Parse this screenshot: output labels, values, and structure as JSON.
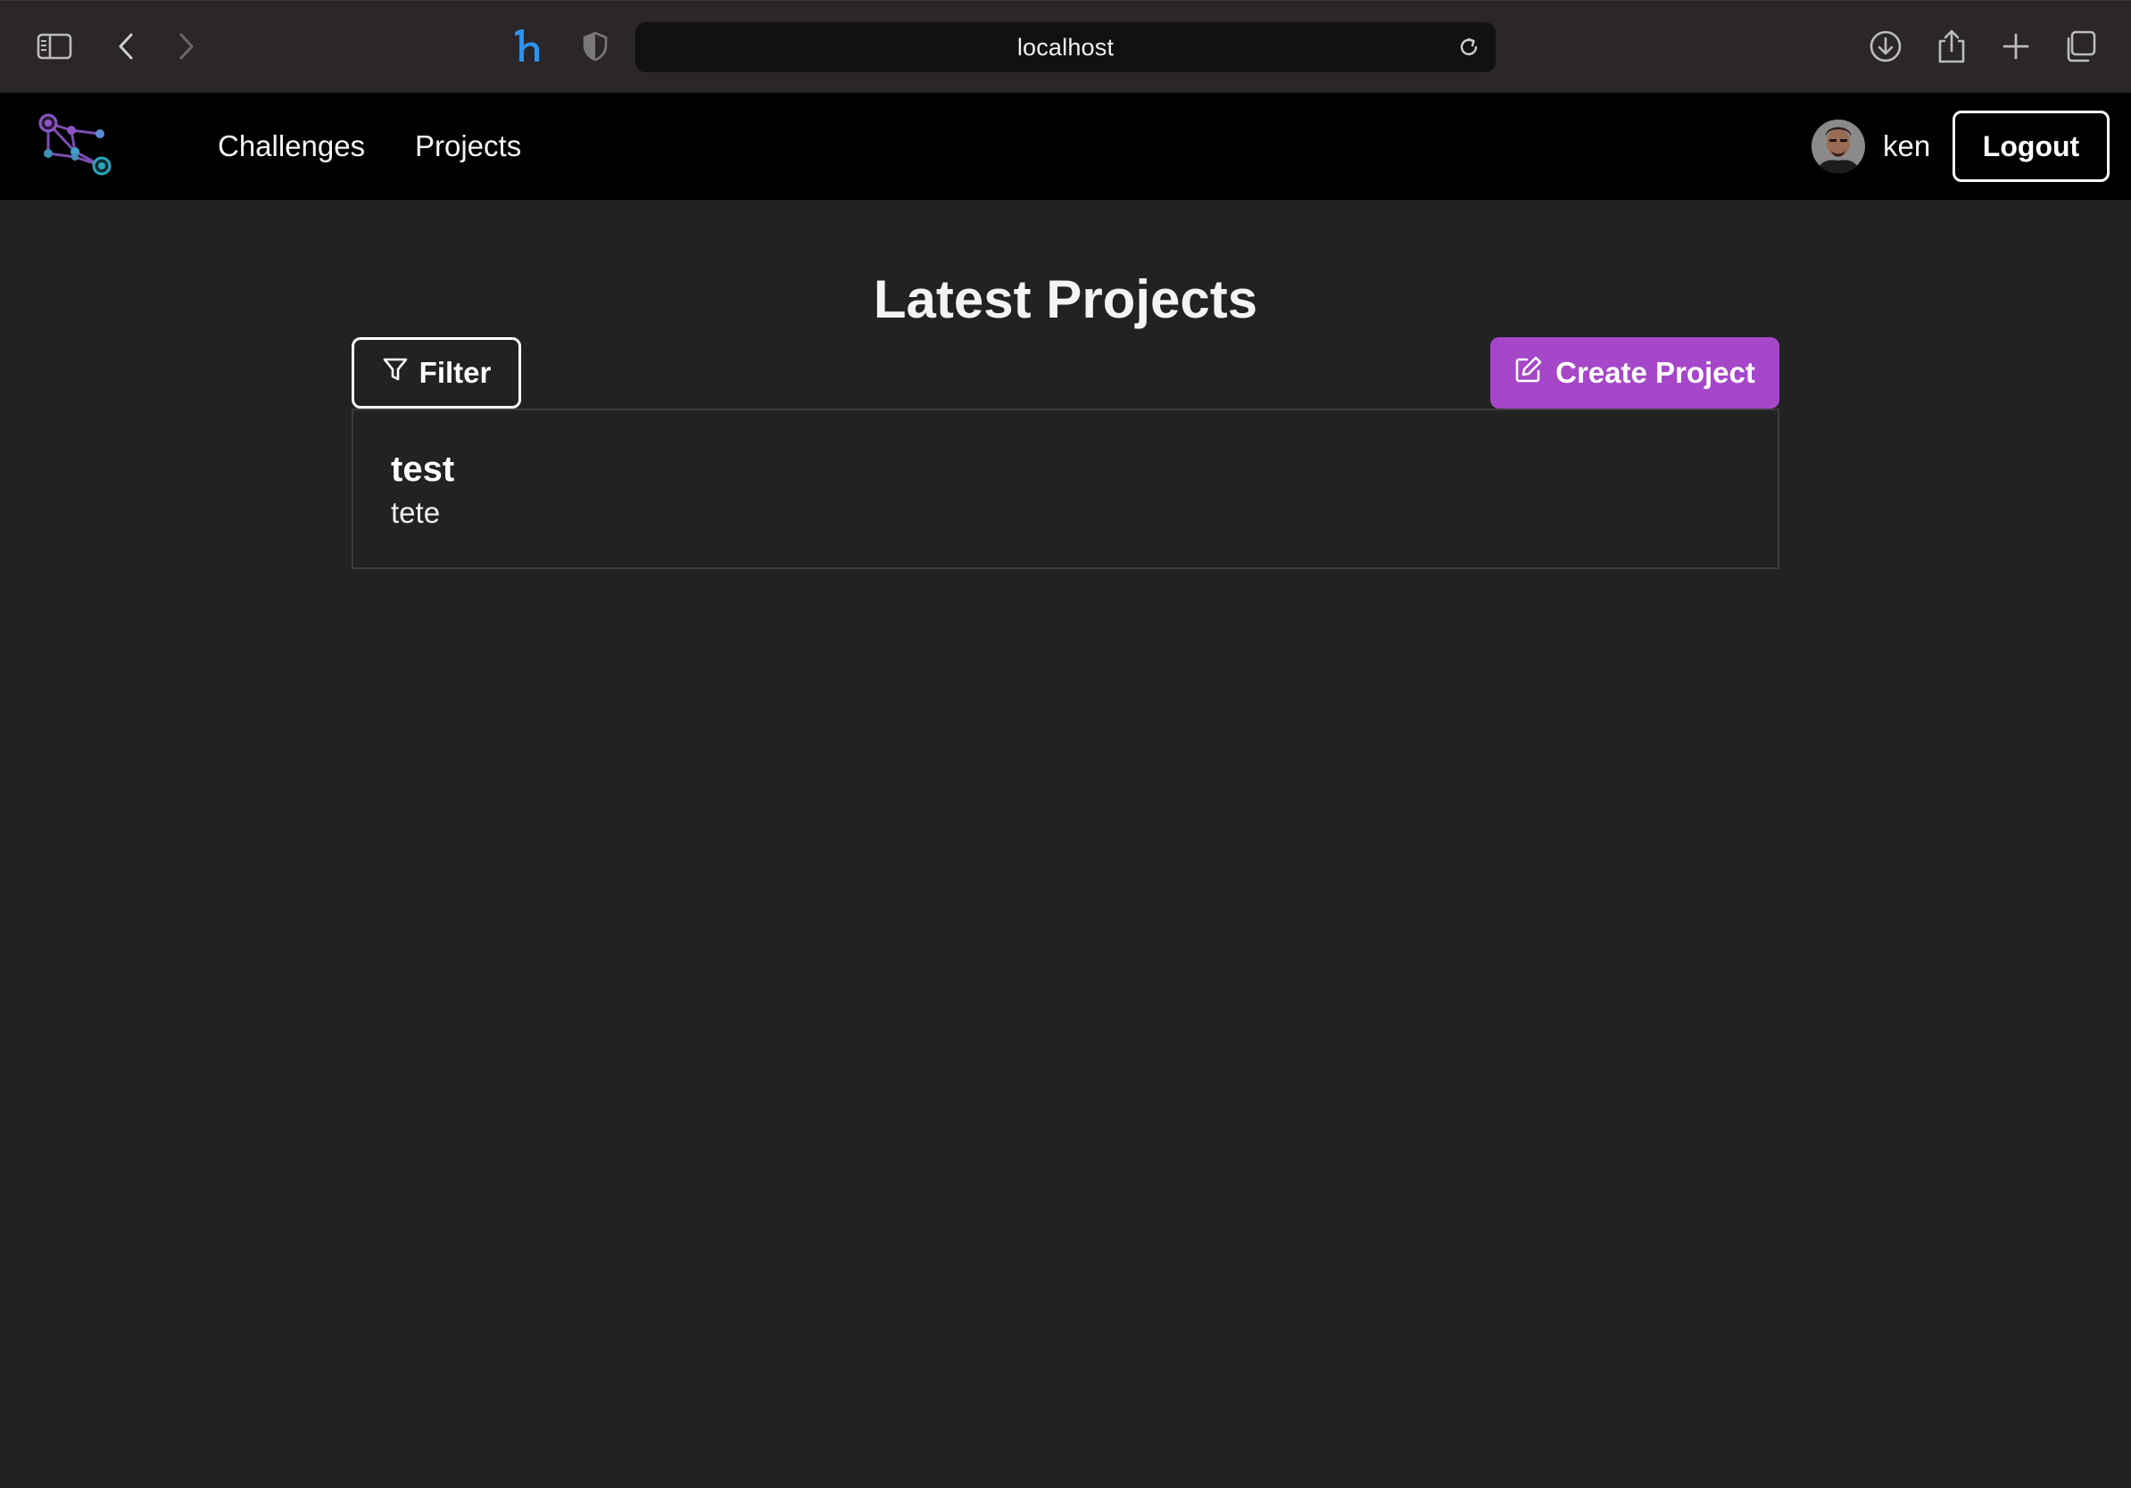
{
  "browser": {
    "url": "localhost",
    "icons": [
      "sidebar-toggle-icon",
      "back-icon",
      "forward-icon",
      "honey-extension-icon",
      "shield-icon",
      "reload-icon",
      "download-icon",
      "share-icon",
      "new-tab-icon",
      "tabs-overview-icon"
    ]
  },
  "nav": {
    "links": [
      "Challenges",
      "Projects"
    ],
    "username": "ken",
    "logout_label": "Logout"
  },
  "main": {
    "title": "Latest Projects",
    "filter_label": "Filter",
    "create_label": "Create Project",
    "projects": [
      {
        "name": "test",
        "description": "tete"
      }
    ]
  },
  "colors": {
    "accent": "#a547c8",
    "background": "#222222",
    "nav_background": "#000000"
  }
}
